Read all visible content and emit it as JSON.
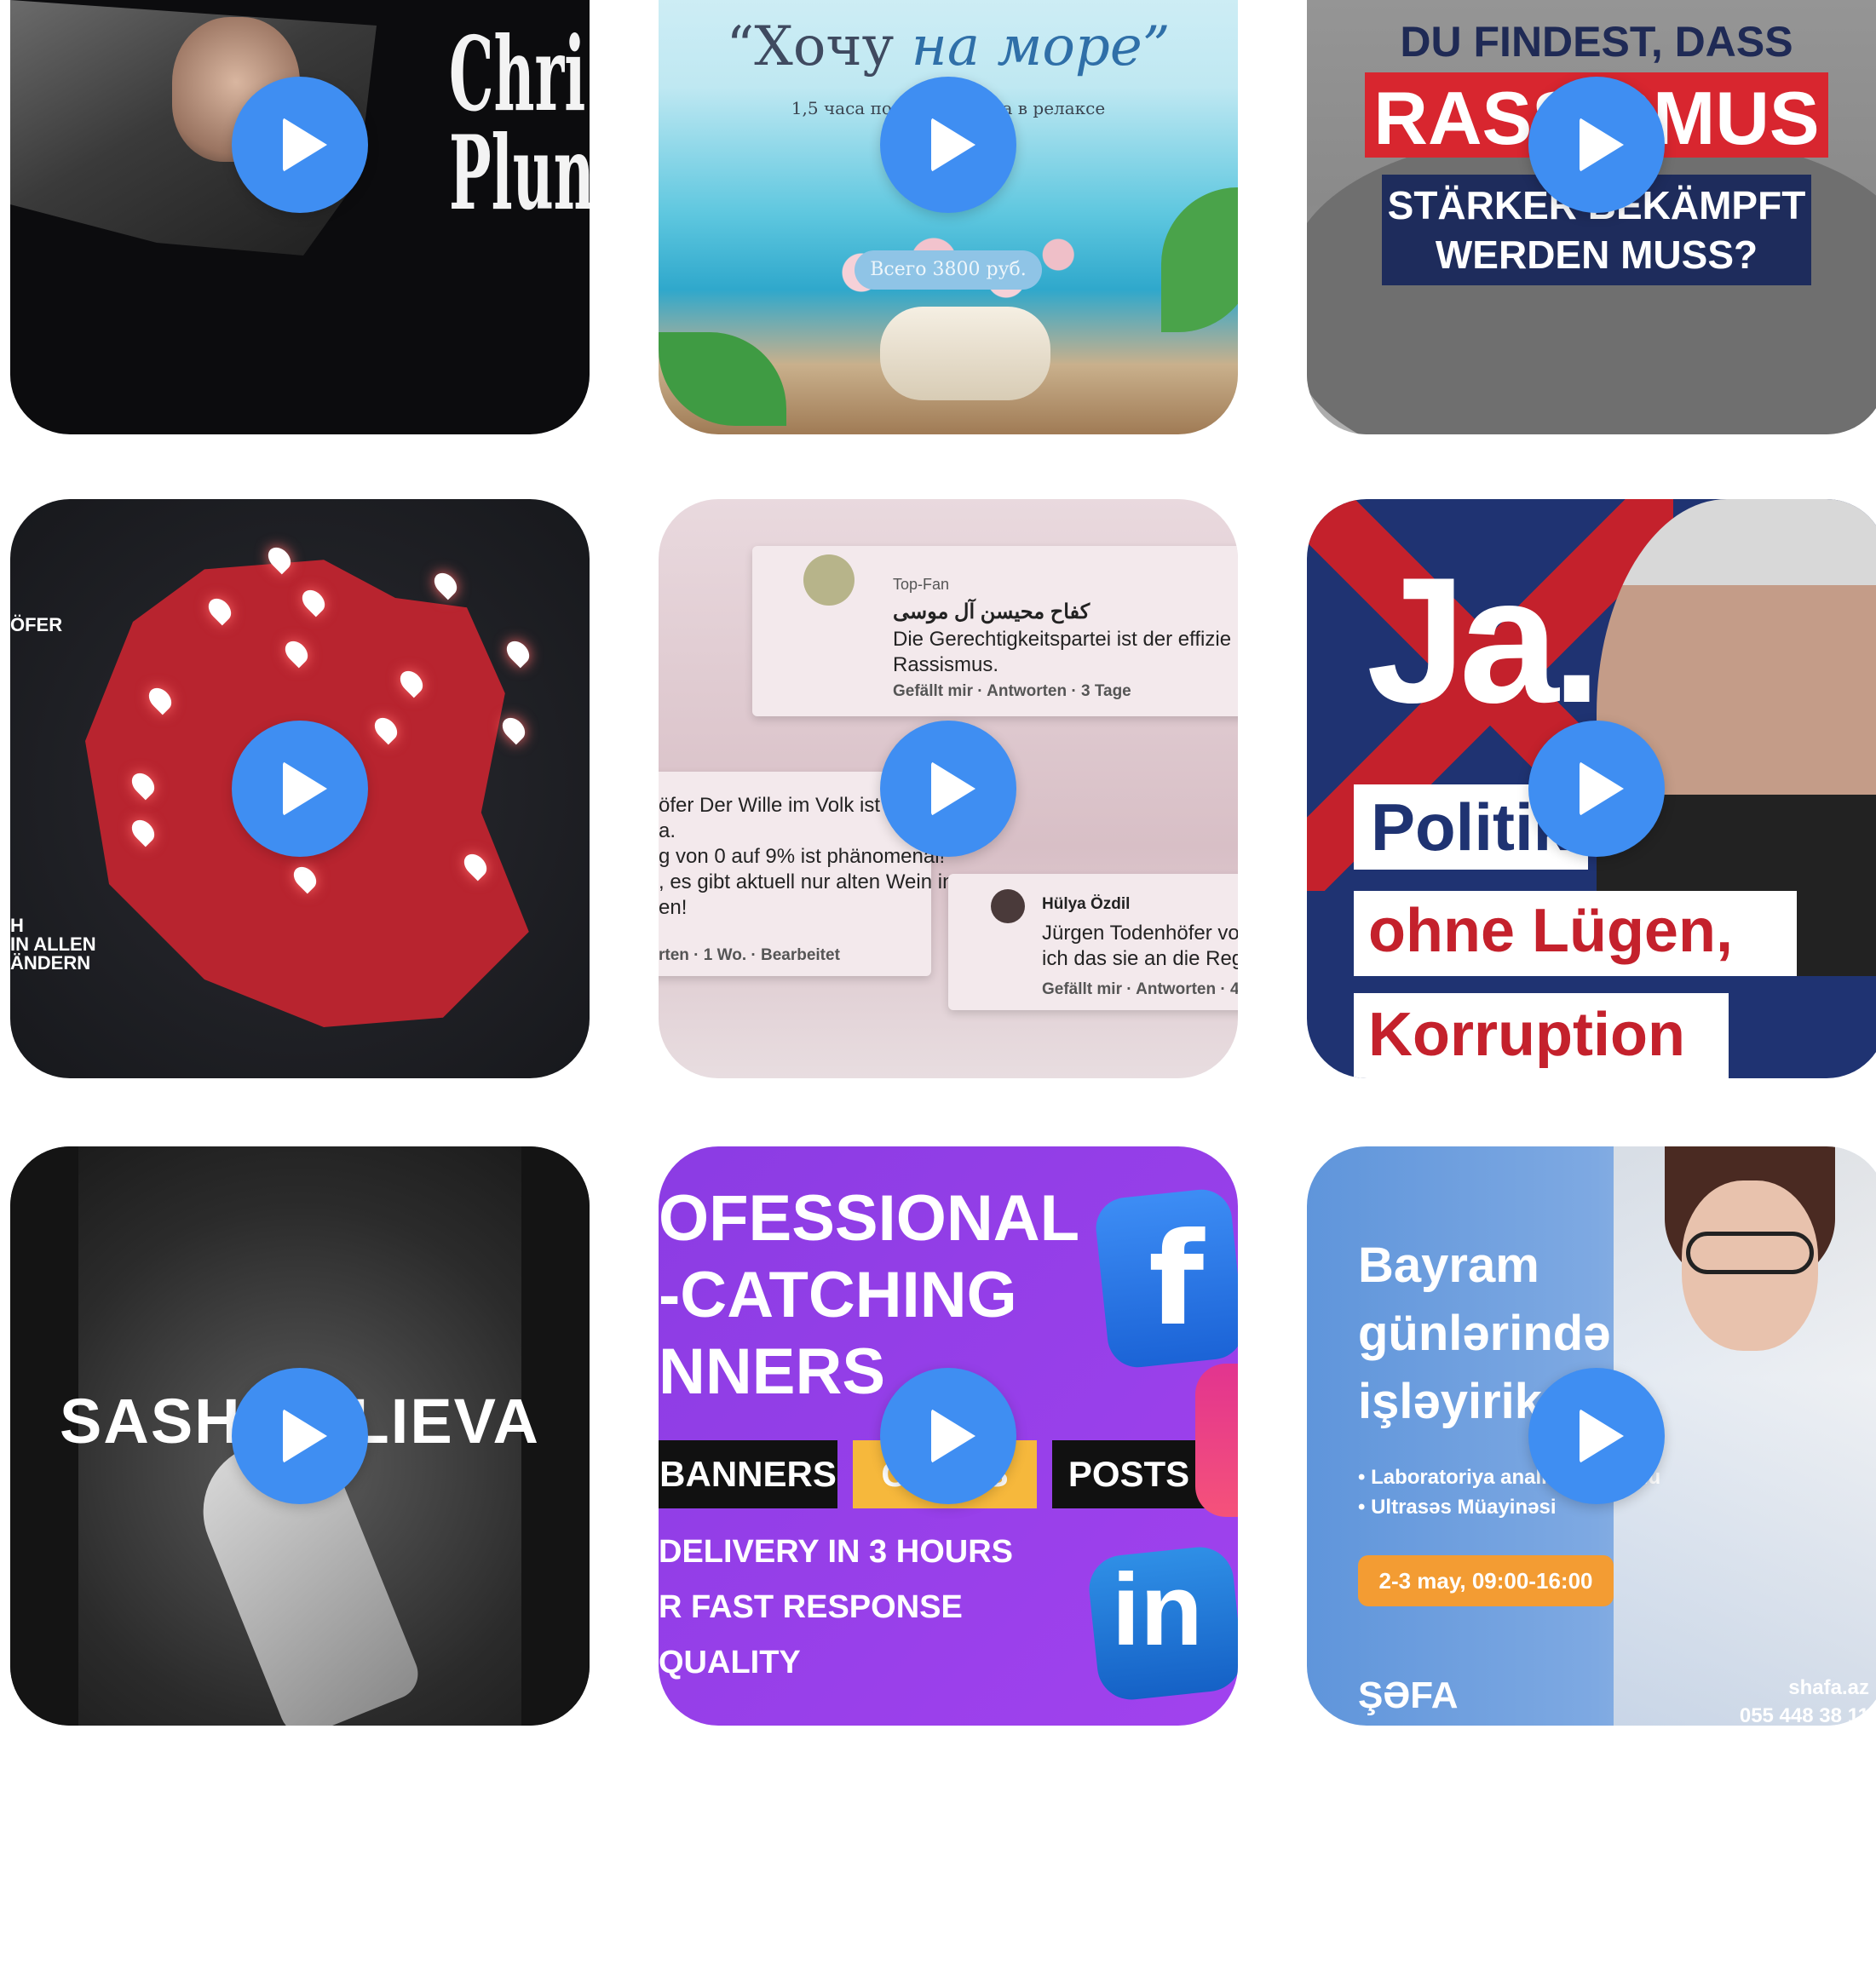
{
  "tiles": [
    {
      "title_text": "Chri\nPlun"
    },
    {
      "headline_a": "“Хочу",
      "headline_b": "на море”",
      "subline": "1,5 часа полного отдыха в релаксе",
      "price": "Всего 3800 руб."
    },
    {
      "line1": "DU FINDEST, DASS",
      "line2": "RASSISMUS",
      "line3": "STÄRKER BEKÄMPFT\nWERDEN MUSS?"
    },
    {
      "side_label": "ÖFER",
      "bottom_label": "H\nIN ALLEN\nÄNDERN"
    },
    {
      "top_fan": "Top-Fan",
      "arabic_name": "كفاح محيسن آل موسى",
      "comment1": "Die Gerechtigkeitspartei ist der effizie\nRassismus.",
      "comment1_meta": "Gefällt mir · Antworten · 3 Tage",
      "comment2": "öfer Der Wille im Volk ist\na.\ng von 0 auf 9% ist phänomenal!\n, es gibt aktuell nur alten Wein in\nen!",
      "comment2_meta": "rten · 1 Wo. · Bearbeitet",
      "comment3_name": "Hülya Özdil",
      "comment3": "Jürgen Todenhöfer vo\nich das sie an die Regi",
      "comment3_meta": "Gefällt mir · Antworten · 4"
    },
    {
      "ja": "Ja.",
      "word1": "Politik",
      "word2": "ohne Lügen,",
      "word3": "Korruption"
    },
    {
      "name": "SASHA ALIEVA"
    },
    {
      "headline": "OFESSIONAL\n-CATCHING\nNNERS",
      "chip1": "BANNERS",
      "chip2": "CARDS",
      "chip3": "POSTS",
      "bullet1": "DELIVERY IN 3 HOURS",
      "bullet2": "R FAST RESPONSE",
      "bullet3": "QUALITY",
      "fb_letter": "f",
      "li_letters": "in"
    },
    {
      "headline": "Bayram\ngünlərində\nişləyirik",
      "item1": "• Laboratoriya analizləri qəbulu",
      "item2": "• Ultrasəs Müayinəsi",
      "date": "2-3 may, 09:00-16:00",
      "logo": "ŞƏFA",
      "url": "shafa.az",
      "phone": "055 448 38 11"
    }
  ],
  "colors": {
    "play_button": "#3f8ef2",
    "page_bg": "#ffffff"
  },
  "icons": {
    "play": "play-icon"
  }
}
